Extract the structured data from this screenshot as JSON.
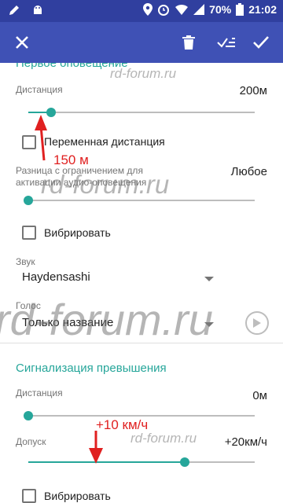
{
  "status_bar": {
    "battery": "70%",
    "time": "21:02"
  },
  "toolbar": {
    "close_icon": "close-icon",
    "delete_icon": "trash-icon",
    "select_all_icon": "check-list-icon",
    "confirm_icon": "check-icon"
  },
  "first_alert": {
    "title": "Первое оповещение",
    "distance_label": "Дистанция",
    "distance_value": "200м",
    "distance_slider_fraction": 0.1,
    "variable_distance_label": "Переменная дистанция",
    "difference_label_line1": "Разница с ограничением для",
    "difference_label_line2": "активации аудио-оповещения",
    "difference_value": "Любое",
    "difference_slider_fraction": 0,
    "vibrate_label": "Вибрировать",
    "sound_label": "Звук",
    "sound_value": "Haydensashi",
    "voice_label": "Голос",
    "voice_value": "Только название"
  },
  "overspeed": {
    "title": "Сигнализация превышения",
    "distance_label": "Дистанция",
    "distance_value": "0м",
    "distance_slider_fraction": 0,
    "tolerance_label": "Допуск",
    "tolerance_value": "+20км/ч",
    "tolerance_slider_fraction": 0.69,
    "vibrate_label": "Вибрировать"
  },
  "annotations": {
    "distance_note": "150 м",
    "tolerance_note": "+10 км/ч",
    "watermark": "rd-forum.ru"
  },
  "colors": {
    "accent": "#26a69a",
    "toolbar": "#3f51b5",
    "statusbar": "#303f9f",
    "annotation": "#e02020"
  }
}
